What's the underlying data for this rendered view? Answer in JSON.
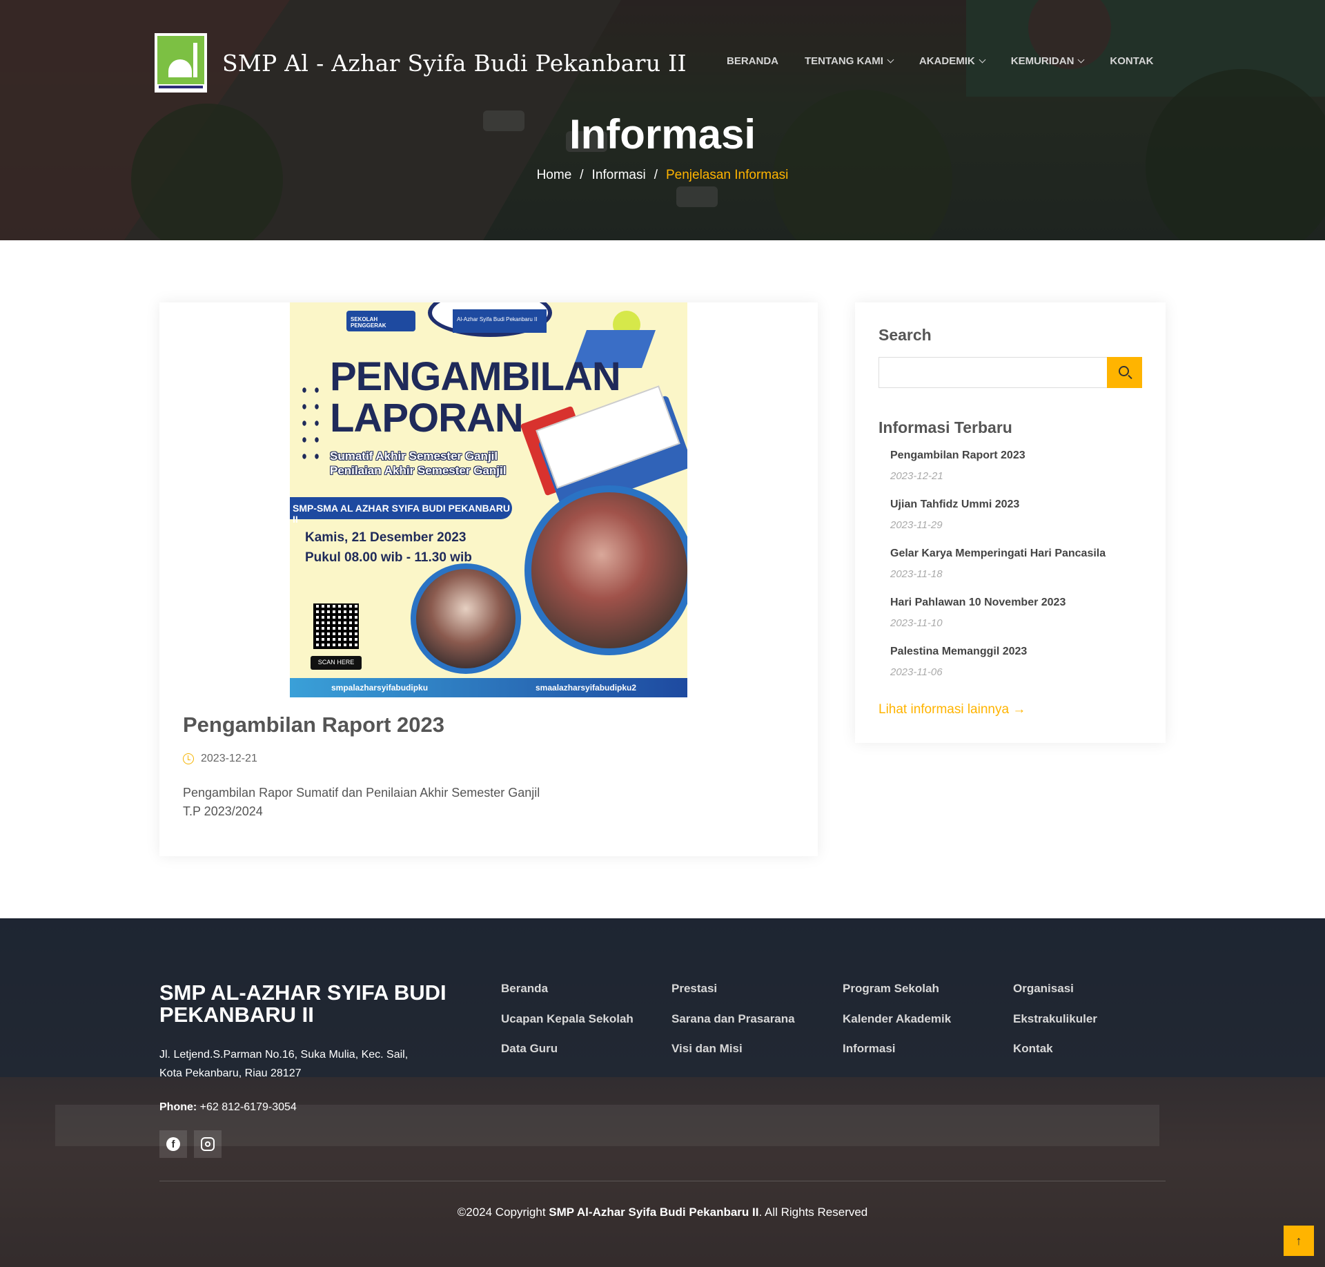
{
  "header": {
    "site_name": "SMP Al - Azhar Syifa Budi Pekanbaru II",
    "logo_icon": "school-logo-mosque",
    "nav": [
      {
        "label": "BERANDA",
        "has_dropdown": false
      },
      {
        "label": "TENTANG KAMI",
        "has_dropdown": true
      },
      {
        "label": "AKADEMIK",
        "has_dropdown": true
      },
      {
        "label": "KEMURIDAN",
        "has_dropdown": true
      },
      {
        "label": "KONTAK",
        "has_dropdown": false
      }
    ]
  },
  "hero": {
    "title": "Informasi",
    "breadcrumb": [
      "Home",
      "Informasi",
      "Penjelasan Informasi"
    ],
    "separator": "/"
  },
  "post": {
    "poster": {
      "badge_left": "SEKOLAH PENGGERAK",
      "badge_center": "Al-Azhar Syifa Budi Pekanbaru II",
      "heading_line1": "PENGAMBILAN",
      "heading_line2": "LAPORAN",
      "sub_line1": "Sumatif Akhir Semester Ganjil",
      "sub_line2": "Penilaian Akhir Semester Ganjil",
      "band": "SMP-SMA AL AZHAR SYIFA BUDI PEKANBARU II",
      "date_line1": "Kamis, 21 Desember 2023",
      "date_line2": "Pukul 08.00 wib - 11.30 wib",
      "scan": "SCAN HERE",
      "ig_left": "smpalazharsyifabudipku",
      "ig_right": "smaalazharsyifabudipku2"
    },
    "title": "Pengambilan Raport 2023",
    "date": "2023-12-21",
    "description": "Pengambilan Rapor Sumatif dan Penilaian Akhir Semester Ganjil T.P 2023/2024"
  },
  "sidebar": {
    "search_heading": "Search",
    "search_value": "",
    "latest_heading": "Informasi Terbaru",
    "items": [
      {
        "title": "Pengambilan Raport 2023",
        "date": "2023-12-21"
      },
      {
        "title": "Ujian Tahfidz Ummi 2023",
        "date": "2023-11-29"
      },
      {
        "title": "Gelar Karya Memperingati Hari Pancasila",
        "date": "2023-11-18"
      },
      {
        "title": "Hari Pahlawan 10 November 2023",
        "date": "2023-11-10"
      },
      {
        "title": "Palestina Memanggil 2023",
        "date": "2023-11-06"
      }
    ],
    "more_link": "Lihat informasi lainnya →"
  },
  "footer": {
    "school_name": "SMP AL-AZHAR SYIFA BUDI PEKANBARU II",
    "address_line1": "Jl. Letjend.S.Parman No.16, Suka Mulia, Kec. Sail,",
    "address_line2": "Kota Pekanbaru, Riau 28127",
    "phone_label": "Phone:",
    "phone": "+62 812-6179-3054",
    "social": [
      "facebook-icon",
      "instagram-icon"
    ],
    "links": [
      [
        "Beranda",
        "Ucapan Kepala Sekolah",
        "Data Guru"
      ],
      [
        "Prestasi",
        "Sarana dan Prasarana",
        "Visi dan Misi"
      ],
      [
        "Program Sekolah",
        "Kalender Akademik",
        "Informasi"
      ],
      [
        "Organisasi",
        "Ekstrakulikuler",
        "Kontak"
      ]
    ],
    "copyright_prefix": "©2024 Copyright",
    "copyright_name": "SMP Al-Azhar Syifa Budi Pekanbaru II",
    "copyright_suffix": ". All Rights Reserved"
  },
  "colors": {
    "accent": "#ffb400",
    "text": "#444444",
    "footer_bg": "#2c3540"
  }
}
